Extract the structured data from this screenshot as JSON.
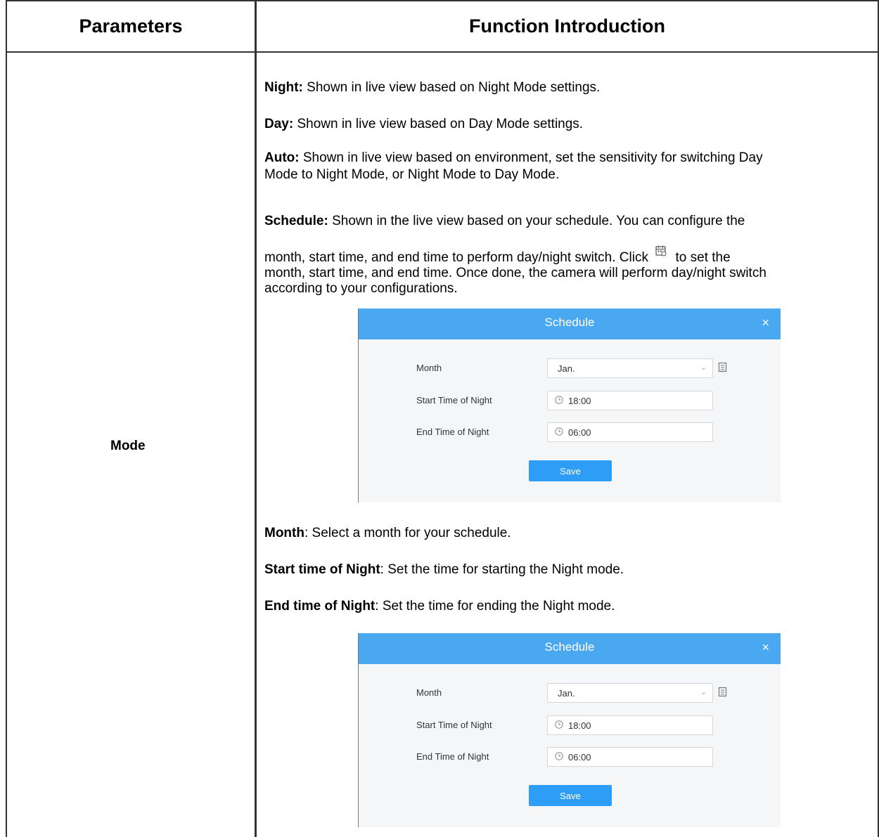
{
  "table": {
    "headers": [
      "Parameters",
      "Function Introduction"
    ],
    "rows": [
      {
        "parameter": "Mode"
      }
    ]
  },
  "content": {
    "night_term": "Night:",
    "night_desc": " Shown in live view based on Night Mode settings.",
    "day_term": "Day:",
    "day_desc": " Shown in live view based on Day Mode settings.",
    "auto_term": "Auto:",
    "auto_desc_1": " Shown in live view based on environment, set the sensitivity for switching Day",
    "auto_desc_2": "Mode to Night Mode, or Night Mode to Day Mode.",
    "schedule_term": "Schedule:",
    "schedule_desc_1": " Shown in the live view based on your schedule. You can configure the",
    "schedule_desc_2a": "month, start time, and end time to perform day/night switch. Click",
    "schedule_desc_2b": "to set the",
    "schedule_desc_3": "month, start time, and end time. Once done, the camera will perform day/night switch",
    "schedule_desc_4": "according to your configurations.",
    "month_term": "Month",
    "month_desc": ": Select a month for your schedule.",
    "start_term": "Start time of Night",
    "start_desc": ": Set the time for starting the Night mode.",
    "end_term": "End time of Night",
    "end_desc": ": Set the time for ending the Night mode.",
    "inline_icon": "calendar-icon"
  },
  "dialog": {
    "title": "Schedule",
    "close": "×",
    "month_label": "Month",
    "month_value": "Jan.",
    "start_label": "Start Time of Night",
    "start_value": "18:00",
    "end_label": "End Time of Night",
    "end_value": "06:00",
    "save_label": "Save",
    "header_color": "#4aa8f0",
    "save_color": "#2e9df5"
  }
}
